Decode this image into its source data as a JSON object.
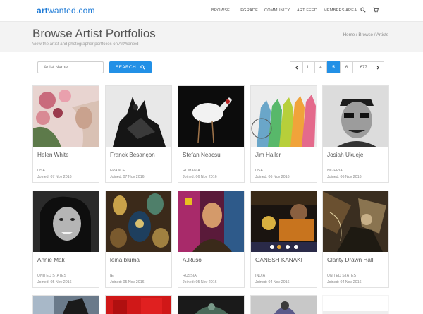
{
  "logo": {
    "part1": "art",
    "part2": "wanted.com"
  },
  "nav": {
    "items": [
      "BROWSE",
      "UPGRADE",
      "COMMUNITY",
      "ART FEED",
      "MEMBERS AREA"
    ]
  },
  "icons": {
    "search": "search-icon",
    "cart": "cart-icon",
    "prev": "chevron-left-icon",
    "next": "chevron-right-icon"
  },
  "page": {
    "title": "Browse Artist Portfolios",
    "subtitle": "View the artist and photographer portfolios on ArtWanted",
    "breadcrumb": "Home / Browse / Artists"
  },
  "search": {
    "placeholder": "Artist Name",
    "button_label": "SEARCH"
  },
  "pagination": {
    "prev": "‹",
    "first": "1..",
    "p4": "4",
    "p5": "5",
    "p6": "6",
    "last": "..677",
    "next": "›",
    "current": "5"
  },
  "colors": {
    "accent": "#2290e6",
    "logo": "#1f7bd6",
    "band": "#f3f3f3"
  },
  "artists": [
    {
      "name": "Helen White",
      "country": "USA",
      "joined": "Joined: 07 Nov 2016"
    },
    {
      "name": "Franck Besançon",
      "country": "FRANCE",
      "joined": "Joined: 07 Nov 2016"
    },
    {
      "name": "Stefan Neacsu",
      "country": "ROMANIA",
      "joined": "Joined: 06 Nov 2016"
    },
    {
      "name": "Jim Haller",
      "country": "USA",
      "joined": "Joined: 06 Nov 2016"
    },
    {
      "name": "Josiah Ukueje",
      "country": "NIGERIA",
      "joined": "Joined: 06 Nov 2016"
    },
    {
      "name": "Annie Mak",
      "country": "UNITED STATES",
      "joined": "Joined: 05 Nov 2016"
    },
    {
      "name": "leina bluma",
      "country": "IE",
      "joined": "Joined: 05 Nov 2016"
    },
    {
      "name": "A.Ruso",
      "country": "RUSSIA",
      "joined": "Joined: 05 Nov 2016"
    },
    {
      "name": "GANESH KANAKI",
      "country": "INDIA",
      "joined": "Joined: 04 Nov 2016"
    },
    {
      "name": "Clarity Drawn Hall",
      "country": "UNITED STATES",
      "joined": "Joined: 04 Nov 2016"
    }
  ]
}
